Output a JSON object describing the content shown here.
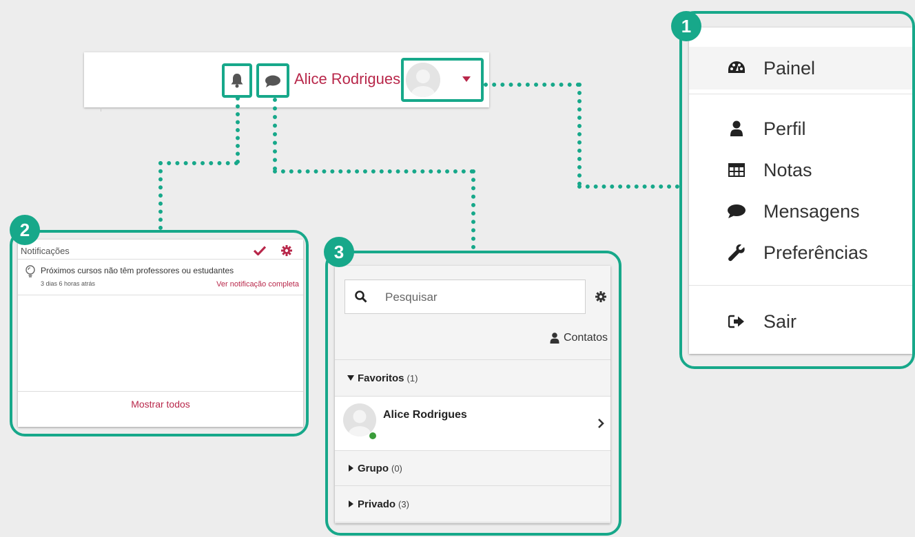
{
  "navbar": {
    "user_name": "Alice Rodrigues"
  },
  "badges": {
    "one": "1",
    "two": "2",
    "three": "3"
  },
  "user_menu": {
    "items": [
      {
        "label": "Painel",
        "icon": "dashboard-icon"
      },
      {
        "label": "Perfil",
        "icon": "user-icon"
      },
      {
        "label": "Notas",
        "icon": "table-icon"
      },
      {
        "label": "Mensagens",
        "icon": "speech-bubble-icon"
      },
      {
        "label": "Preferências",
        "icon": "wrench-icon"
      },
      {
        "label": "Sair",
        "icon": "sign-out-icon"
      }
    ]
  },
  "notifications": {
    "title": "Notificações",
    "item_text": "Próximos cursos não têm professores ou estudantes",
    "item_time": "3 dias 6 horas atrás",
    "item_link": "Ver notificação completa",
    "show_all": "Mostrar todos"
  },
  "messages": {
    "search_placeholder": "Pesquisar",
    "contacts_label": "Contatos",
    "favorites_label": "Favoritos",
    "favorites_count": "(1)",
    "favorite_contact": "Alice Rodrigues",
    "group_label": "Grupo",
    "group_count": "(0)",
    "private_label": "Privado",
    "private_count": "(3)"
  },
  "colors": {
    "accent": "#17a88a",
    "brand_red": "#b8274a"
  }
}
